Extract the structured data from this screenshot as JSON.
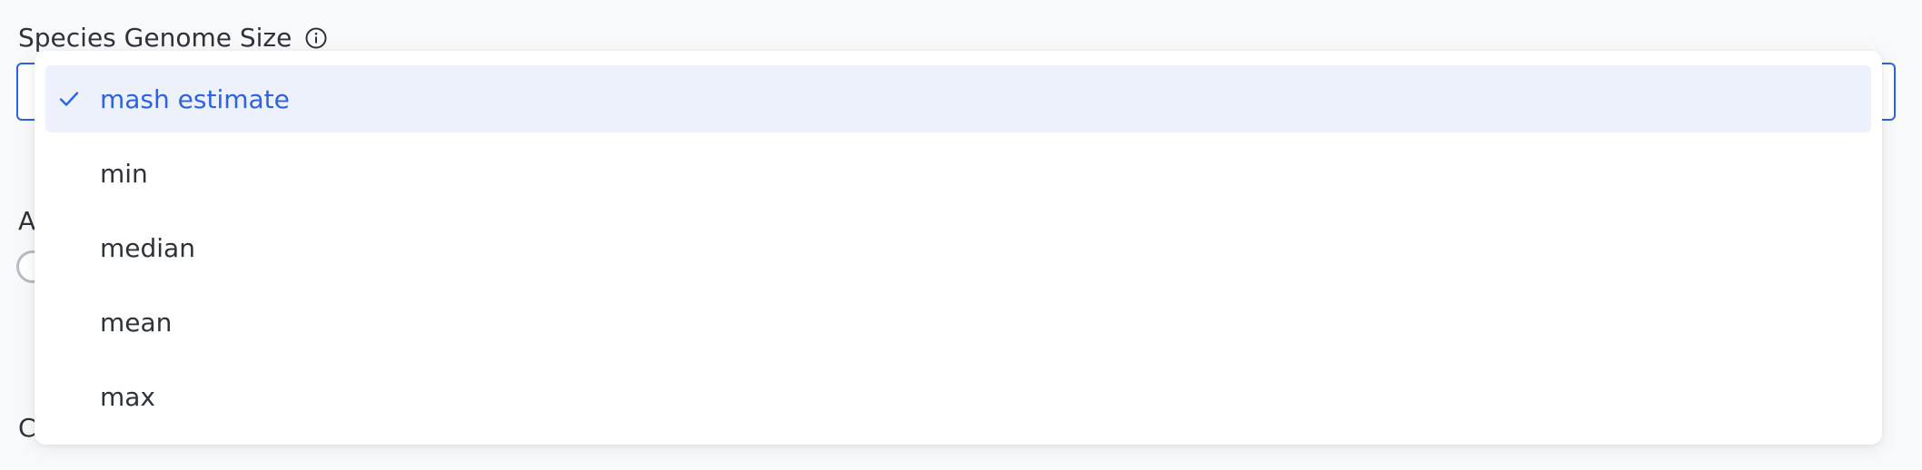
{
  "form": {
    "genome_size_label": "Species Genome Size",
    "info_icon": "info-circle-icon",
    "partial_label_a": "A",
    "partial_label_c": "C"
  },
  "dropdown": {
    "selected_value": "mash estimate",
    "check_icon": "checkmark-icon",
    "options": [
      {
        "label": "mash estimate",
        "selected": true
      },
      {
        "label": "min",
        "selected": false
      },
      {
        "label": "median",
        "selected": false
      },
      {
        "label": "mean",
        "selected": false
      },
      {
        "label": "max",
        "selected": false
      }
    ]
  },
  "colors": {
    "accent": "#2e62e5",
    "selected_bg": "#edf1fc",
    "text": "#2f3339"
  }
}
